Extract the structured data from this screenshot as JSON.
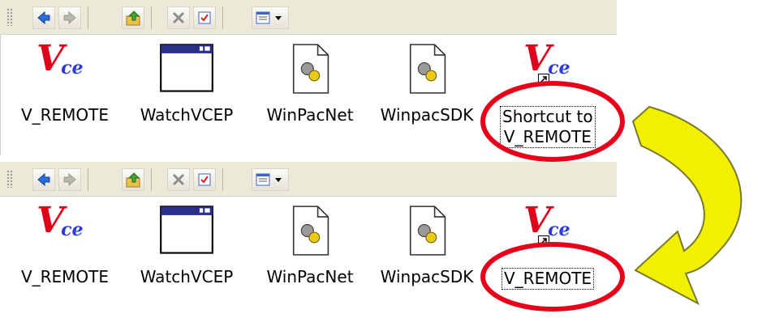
{
  "panels": [
    {
      "items": [
        {
          "label": "V_REMOTE",
          "icon": "vce-logo-icon"
        },
        {
          "label": "WatchVCEP",
          "icon": "window-app-icon"
        },
        {
          "label": "WinPacNet",
          "icon": "gear-document-icon"
        },
        {
          "label": "WinpacSDK",
          "icon": "gear-document-icon"
        },
        {
          "label_line1": "Shortcut to",
          "label_line2": "V_REMOTE",
          "icon": "vce-shortcut-icon"
        }
      ]
    },
    {
      "items": [
        {
          "label": "V_REMOTE",
          "icon": "vce-logo-icon"
        },
        {
          "label": "WatchVCEP",
          "icon": "window-app-icon"
        },
        {
          "label": "WinPacNet",
          "icon": "gear-document-icon"
        },
        {
          "label": "WinpacSDK",
          "icon": "gear-document-icon"
        },
        {
          "label": "V_REMOTE",
          "icon": "vce-shortcut-icon"
        }
      ]
    }
  ],
  "logo_text": {
    "main": "V",
    "sub": "ce"
  },
  "colors": {
    "annotation_circle": "#e8001a",
    "arrow_fill": "#f2f000",
    "arrow_stroke": "#7a7a2a"
  }
}
